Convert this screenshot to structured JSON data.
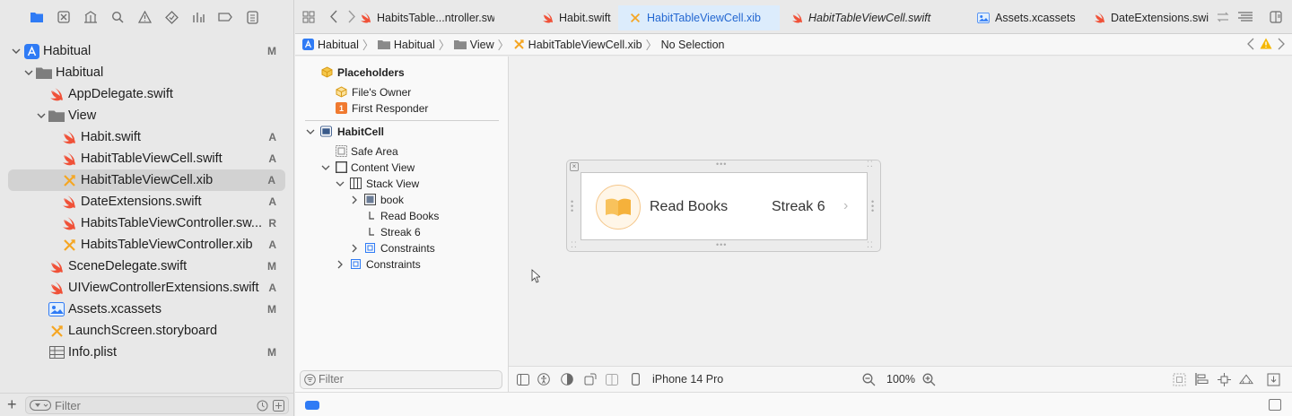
{
  "navigator": {
    "tree": [
      {
        "label": "Habitual",
        "status": "M",
        "kind": "project",
        "indent": 0,
        "disclosure": "open"
      },
      {
        "label": "Habitual",
        "status": "",
        "kind": "folder",
        "indent": 1,
        "disclosure": "open"
      },
      {
        "label": "AppDelegate.swift",
        "status": "",
        "kind": "swift",
        "indent": 2,
        "disclosure": ""
      },
      {
        "label": "View",
        "status": "",
        "kind": "folder",
        "indent": 2,
        "disclosure": "open"
      },
      {
        "label": "Habit.swift",
        "status": "A",
        "kind": "swift",
        "indent": 3,
        "disclosure": ""
      },
      {
        "label": "HabitTableViewCell.swift",
        "status": "A",
        "kind": "swift",
        "indent": 3,
        "disclosure": ""
      },
      {
        "label": "HabitTableViewCell.xib",
        "status": "A",
        "kind": "xib",
        "indent": 3,
        "disclosure": "",
        "selected": true
      },
      {
        "label": "DateExtensions.swift",
        "status": "A",
        "kind": "swift",
        "indent": 3,
        "disclosure": ""
      },
      {
        "label": "HabitsTableViewController.sw...",
        "status": "R",
        "kind": "swift",
        "indent": 3,
        "disclosure": ""
      },
      {
        "label": "HabitsTableViewController.xib",
        "status": "A",
        "kind": "xib",
        "indent": 3,
        "disclosure": ""
      },
      {
        "label": "SceneDelegate.swift",
        "status": "M",
        "kind": "swift",
        "indent": 2,
        "disclosure": ""
      },
      {
        "label": "UIViewControllerExtensions.swift",
        "status": "A",
        "kind": "swift",
        "indent": 2,
        "disclosure": ""
      },
      {
        "label": "Assets.xcassets",
        "status": "M",
        "kind": "assets",
        "indent": 2,
        "disclosure": ""
      },
      {
        "label": "LaunchScreen.storyboard",
        "status": "",
        "kind": "xib",
        "indent": 2,
        "disclosure": ""
      },
      {
        "label": "Info.plist",
        "status": "M",
        "kind": "plist",
        "indent": 2,
        "disclosure": ""
      }
    ],
    "filter_placeholder": "Filter"
  },
  "tabs": [
    {
      "label": "HabitsTable...ntroller.swift",
      "kind": "swift",
      "active": false,
      "italic": false
    },
    {
      "label": "Habit.swift",
      "kind": "swift",
      "active": false,
      "italic": false
    },
    {
      "label": "HabitTableViewCell.xib",
      "kind": "xib",
      "active": true,
      "italic": false
    },
    {
      "label": "HabitTableViewCell.swift",
      "kind": "swift",
      "active": false,
      "italic": true
    },
    {
      "label": "Assets.xcassets",
      "kind": "assets",
      "active": false,
      "italic": false
    },
    {
      "label": "DateExtensions.swi",
      "kind": "swift",
      "active": false,
      "italic": false
    }
  ],
  "jumpbar": {
    "project": "Habitual",
    "group": "Habitual",
    "subgroup": "View",
    "file": "HabitTableViewCell.xib",
    "selection": "No Selection"
  },
  "outline": {
    "placeholders_header": "Placeholders",
    "files_owner": "File's Owner",
    "first_responder": "First Responder",
    "first_responder_badge": "1",
    "cell": "HabitCell",
    "safe_area": "Safe Area",
    "content_view": "Content View",
    "stack_view": "Stack View",
    "book": "book",
    "read_books": "Read Books",
    "streak": "Streak 6",
    "constraints_inner": "Constraints",
    "constraints_outer": "Constraints",
    "filter_placeholder": "Filter"
  },
  "canvas": {
    "cell_title": "Read Books",
    "cell_streak": "Streak 6",
    "device": "iPhone 14 Pro",
    "zoom": "100%"
  },
  "colors": {
    "accent": "#2f7bf5",
    "swift_orange": "#f05138",
    "xib_orange": "#f5a623"
  }
}
